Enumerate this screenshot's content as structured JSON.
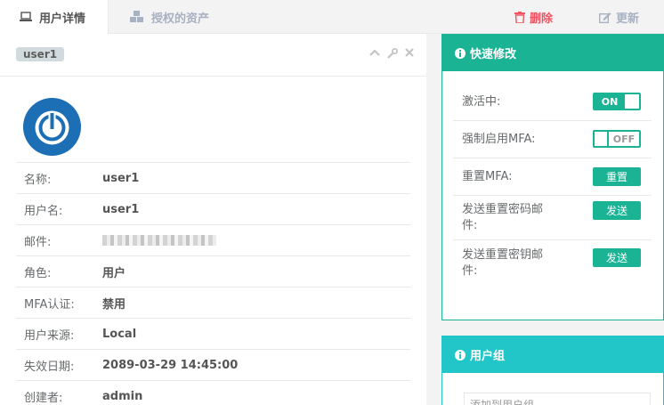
{
  "tabs": [
    {
      "label": "用户详情",
      "icon": "laptop-icon"
    },
    {
      "label": "授权的资产",
      "icon": "cubes-icon"
    }
  ],
  "actions": {
    "delete": "删除",
    "update": "更新"
  },
  "user": {
    "badge": "user1",
    "fields": [
      {
        "key": "名称:",
        "value": "user1"
      },
      {
        "key": "用户名:",
        "value": "user1"
      },
      {
        "key": "邮件:",
        "value": ""
      },
      {
        "key": "角色:",
        "value": "用户"
      },
      {
        "key": "MFA认证:",
        "value": "禁用"
      },
      {
        "key": "用户来源:",
        "value": "Local"
      },
      {
        "key": "失效日期:",
        "value": "2089-03-29 14:45:00"
      },
      {
        "key": "创建者:",
        "value": "admin"
      }
    ]
  },
  "quick": {
    "title": "快速修改",
    "rows": [
      {
        "label": "激活中:",
        "control": "ON"
      },
      {
        "label": "强制启用MFA:",
        "control": "OFF"
      },
      {
        "label": "重置MFA:",
        "control": "重置"
      },
      {
        "label": "发送重置密码邮件:",
        "control": "发送"
      },
      {
        "label": "发送重置密钥邮件:",
        "control": "发送"
      }
    ]
  },
  "group": {
    "title": "用户组",
    "placeholder": "添加到用户组"
  },
  "colors": {
    "primary": "#1ab394",
    "info": "#23c6c8",
    "danger": "#ed5565"
  }
}
